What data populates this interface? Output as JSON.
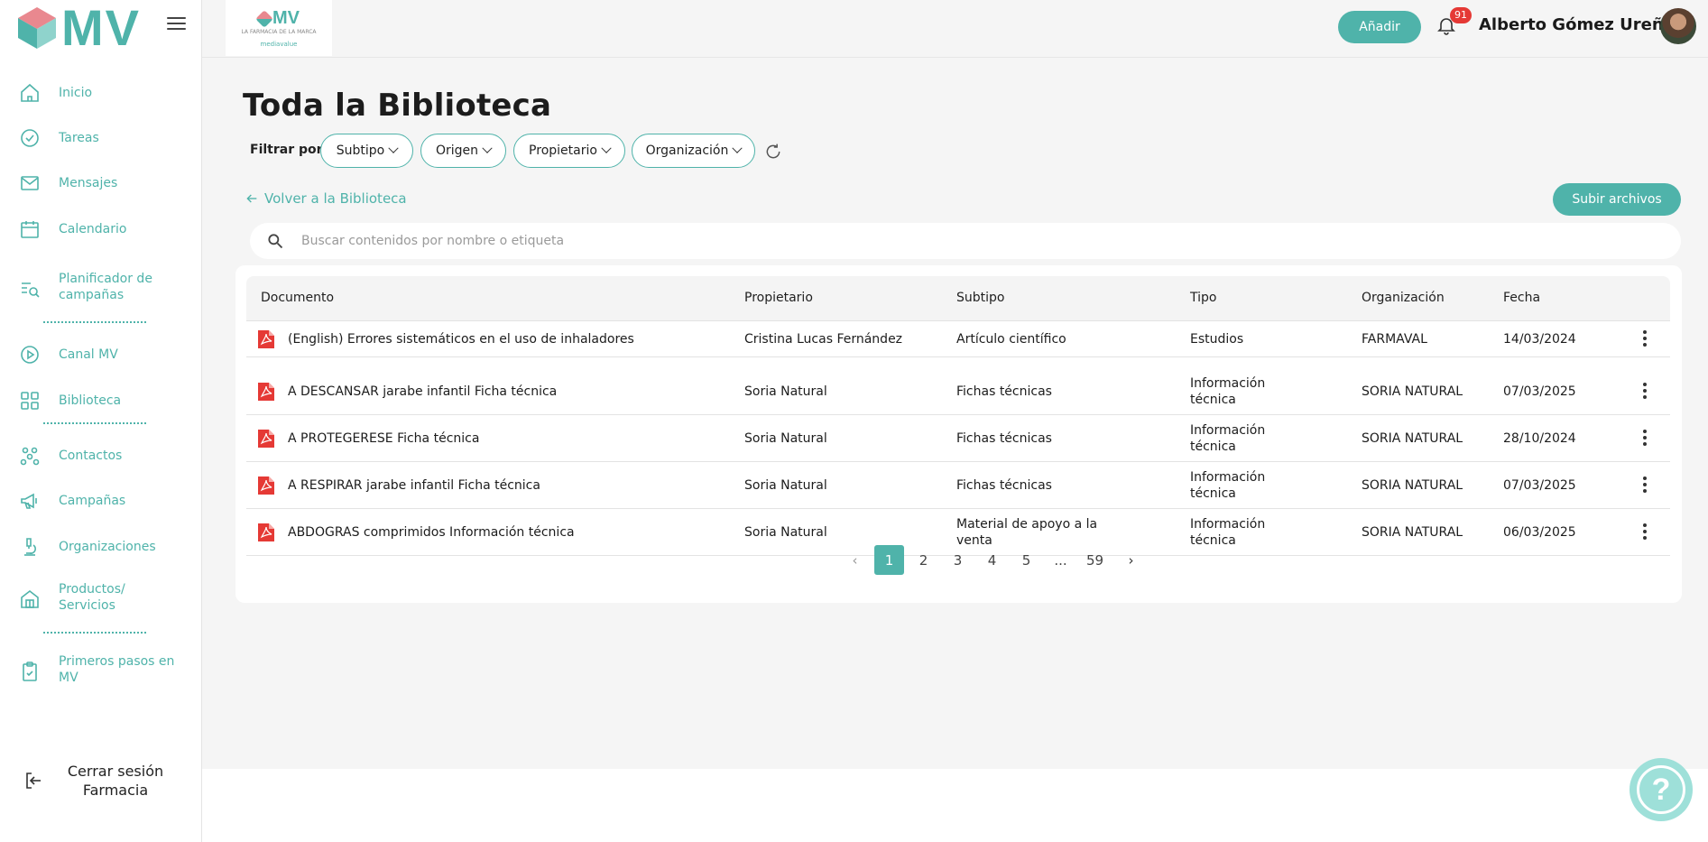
{
  "app": {
    "logo_text": "MV"
  },
  "sidebar": {
    "items": [
      {
        "label": "Inicio",
        "icon": "home-icon"
      },
      {
        "label": "Tareas",
        "icon": "check-circle-icon"
      },
      {
        "label": "Mensajes",
        "icon": "mail-icon"
      },
      {
        "label": "Calendario",
        "icon": "calendar-icon"
      },
      {
        "label": "Planificador de campañas",
        "icon": "planner-icon"
      },
      {
        "label": "Canal MV",
        "icon": "play-icon"
      },
      {
        "label": "Biblioteca",
        "icon": "grid-icon"
      },
      {
        "label": "Contactos",
        "icon": "contacts-icon"
      },
      {
        "label": "Campañas",
        "icon": "megaphone-icon"
      },
      {
        "label": "Organizaciones",
        "icon": "microscope-icon"
      },
      {
        "label": "Productos/ Servicios",
        "icon": "store-icon"
      },
      {
        "label": "Primeros pasos en MV",
        "icon": "clipboard-icon"
      }
    ],
    "logout_label": "Cerrar sesión Farmacia"
  },
  "topbar": {
    "org_logo": {
      "text": "MV",
      "subtext": "LA FARMACIA DE LA MARCA",
      "subtext2": "mediavalue"
    },
    "add_label": "Añadir",
    "notifications_count": "91",
    "user_name": "Alberto Gómez Ureña"
  },
  "main": {
    "title": "Toda la Biblioteca",
    "filter_label": "Filtrar por:",
    "filters": [
      "Subtipo",
      "Origen",
      "Propietario",
      "Organización"
    ],
    "back_label": "Volver a la Biblioteca",
    "upload_label": "Subir archivos",
    "search_placeholder": "Buscar contenidos por nombre o etiqueta",
    "table": {
      "headers": [
        "Documento",
        "Propietario",
        "Subtipo",
        "Tipo",
        "Organización",
        "Fecha"
      ],
      "rows": [
        [
          "(English) Errores sistemáticos en el uso de inhaladores",
          "Cristina Lucas Fernández",
          "Artículo científico",
          "Estudios",
          "FARMAVAL",
          "14/03/2024"
        ],
        [
          "A DESCANSAR jarabe infantil Ficha técnica",
          "Soria Natural",
          "Fichas técnicas",
          "Información técnica",
          "SORIA NATURAL",
          "07/03/2025"
        ],
        [
          "A PROTEGERESE Ficha técnica",
          "Soria Natural",
          "Fichas técnicas",
          "Información técnica",
          "SORIA NATURAL",
          "28/10/2024"
        ],
        [
          "A RESPIRAR jarabe infantil Ficha técnica",
          "Soria Natural",
          "Fichas técnicas",
          "Información técnica",
          "SORIA NATURAL",
          "07/03/2025"
        ],
        [
          "ABDOGRAS comprimidos Información técnica",
          "Soria Natural",
          "Material de apoyo a la venta",
          "Información técnica",
          "SORIA NATURAL",
          "06/03/2025"
        ]
      ]
    },
    "pagination": {
      "pages": [
        "1",
        "2",
        "3",
        "4",
        "5",
        "...",
        "59"
      ],
      "current": "1"
    }
  },
  "colors": {
    "accent": "#4fb3aa",
    "badge": "#e53935",
    "pdf": "#e53935"
  }
}
